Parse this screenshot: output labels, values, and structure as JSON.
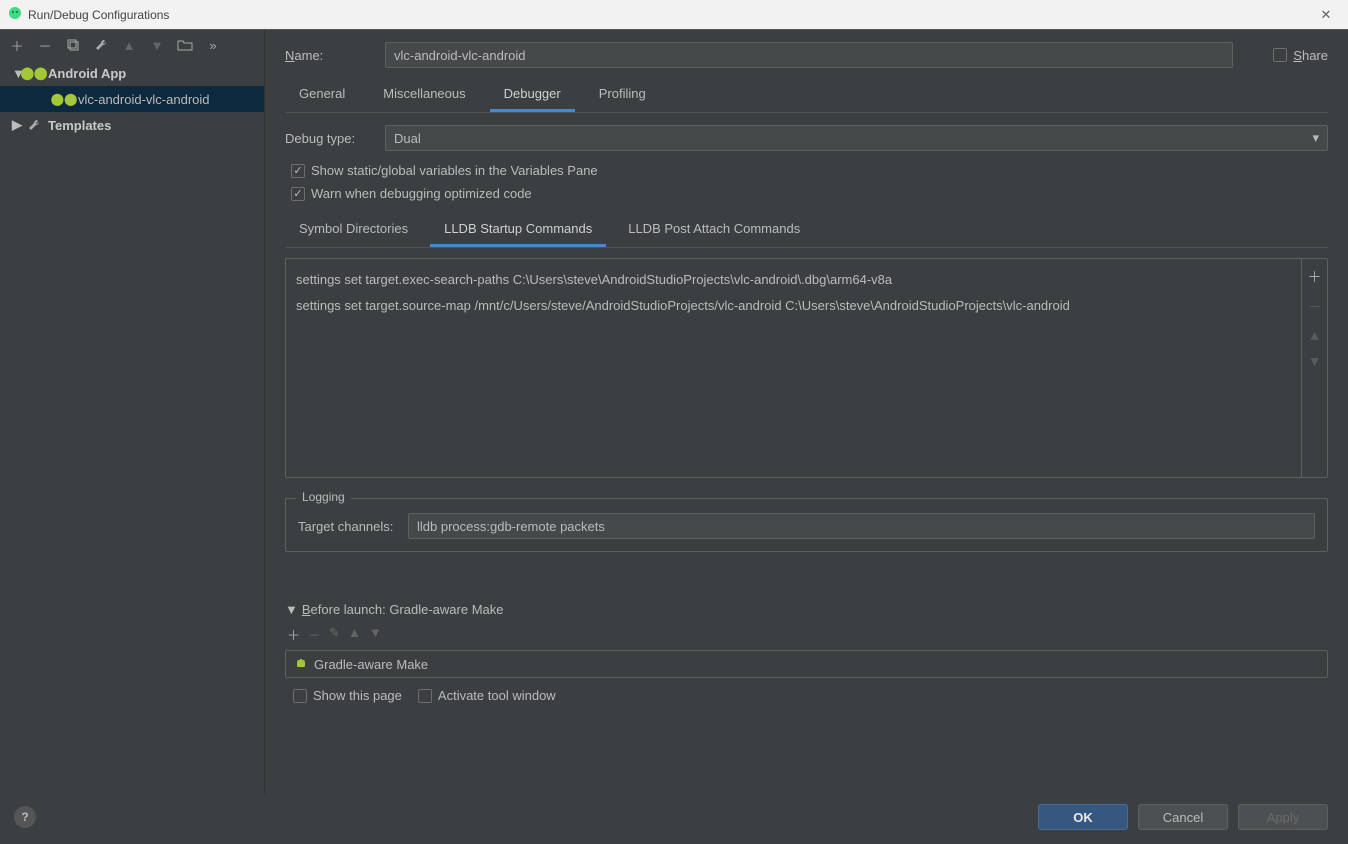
{
  "window": {
    "title": "Run/Debug Configurations"
  },
  "share_label": "Share",
  "sidebar": {
    "android_app": "Android App",
    "config_name": "vlc-android-vlc-android",
    "templates": "Templates"
  },
  "name_label": "Name:",
  "name_value": "vlc-android-vlc-android",
  "tabs": {
    "general": "General",
    "misc": "Miscellaneous",
    "debugger": "Debugger",
    "profiling": "Profiling"
  },
  "debug_type_label": "Debug type:",
  "debug_type_value": "Dual",
  "check_static": "Show static/global variables in the Variables Pane",
  "check_warn": "Warn when debugging optimized code",
  "subtabs": {
    "symbol": "Symbol Directories",
    "startup": "LLDB Startup Commands",
    "postattach": "LLDB Post Attach Commands"
  },
  "startup_commands": [
    "settings set target.exec-search-paths C:\\Users\\steve\\AndroidStudioProjects\\vlc-android\\.dbg\\arm64-v8a",
    "settings set target.source-map /mnt/c/Users/steve/AndroidStudioProjects/vlc-android C:\\Users\\steve\\AndroidStudioProjects\\vlc-android"
  ],
  "logging_legend": "Logging",
  "target_channels_label": "Target channels:",
  "target_channels_value": "lldb process:gdb-remote packets",
  "before_launch": {
    "title": "Before launch: Gradle-aware Make",
    "item": "Gradle-aware Make",
    "show_this_page": "Show this page",
    "activate_tool_window": "Activate tool window"
  },
  "buttons": {
    "ok": "OK",
    "cancel": "Cancel",
    "apply": "Apply"
  }
}
